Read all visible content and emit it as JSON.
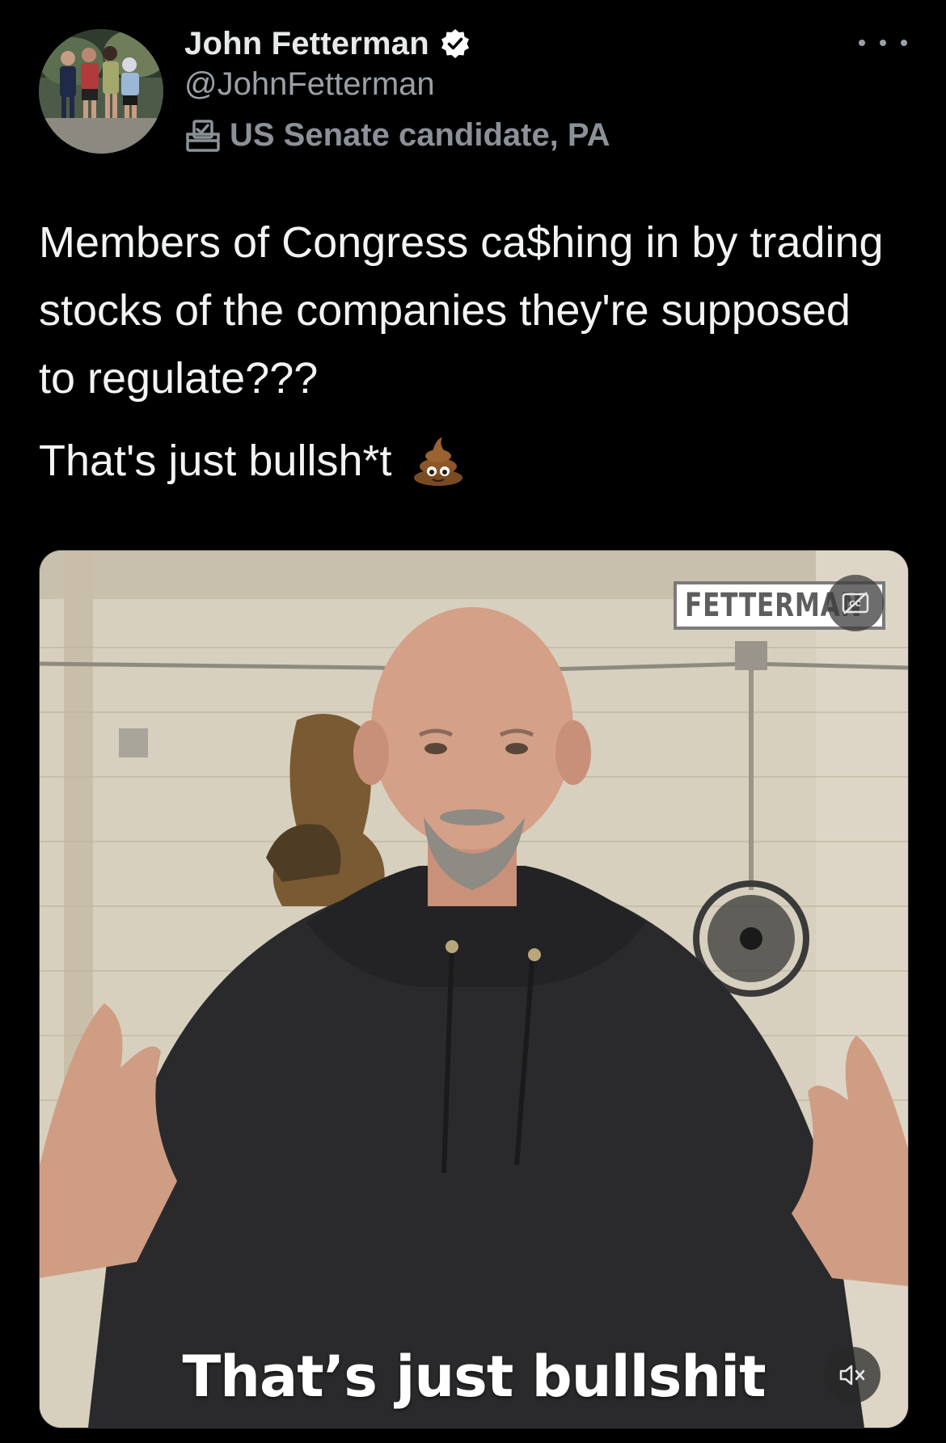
{
  "author": {
    "display_name": "John Fetterman",
    "handle": "@JohnFetterman",
    "affiliation": "US Senate candidate, PA",
    "verified": true,
    "avatar_icon": "family-photo-avatar",
    "label_icon": "ballot-box-icon"
  },
  "menu": {
    "icon": "more-options-icon"
  },
  "tweet": {
    "text_paragraph_1": "Members of Congress ca$hing in by trading stocks of the companies they're supposed to regulate???",
    "text_paragraph_2": "That's just bullsh*t",
    "emoji_icon": "pile-of-poo-icon"
  },
  "media": {
    "type": "video",
    "brand_sign": "FETTERMAN",
    "caption": "That’s just bullshit",
    "cc_icon": "closed-captions-off-icon",
    "mute_icon": "muted-speaker-icon"
  },
  "colors": {
    "background": "#000000",
    "primary_text": "#e7e9ea",
    "secondary_text": "#9aa0a6",
    "verified_badge": "#ffffff"
  }
}
